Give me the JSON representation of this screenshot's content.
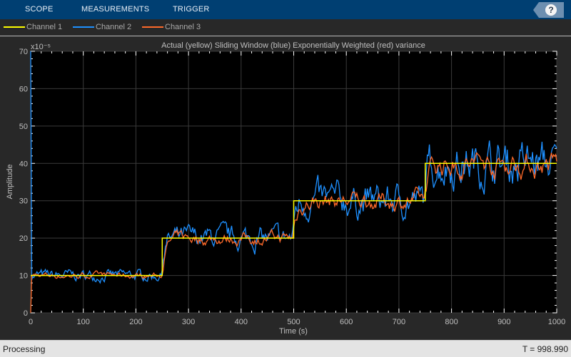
{
  "toolbar": {
    "tabs": [
      "SCOPE",
      "MEASUREMENTS",
      "TRIGGER"
    ],
    "help_label": "?"
  },
  "legend": [
    {
      "label": "Channel 1",
      "color": "#ffff00"
    },
    {
      "label": "Channel 2",
      "color": "#1e90ff"
    },
    {
      "label": "Channel 3",
      "color": "#ff6a2a"
    }
  ],
  "status": {
    "left": "Processing",
    "right": "T = 998.990"
  },
  "chart_data": {
    "type": "line",
    "title": "Actual (yellow) Sliding Window (blue) Exponentially Weighted (red) variance",
    "xlabel": "Time (s)",
    "ylabel": "Amplitude",
    "y_exponent": "x10⁻⁵",
    "xlim": [
      0,
      1000
    ],
    "ylim": [
      0,
      70
    ],
    "xticks": [
      0,
      100,
      200,
      300,
      400,
      500,
      600,
      700,
      800,
      900,
      1000
    ],
    "yticks": [
      0,
      10,
      20,
      30,
      40,
      50,
      60,
      70
    ],
    "grid": true,
    "legend_position": "top",
    "series": [
      {
        "name": "Channel 1",
        "color": "#ffff00",
        "steps": [
          {
            "from": 0,
            "to": 250,
            "value": 10
          },
          {
            "from": 250,
            "to": 500,
            "value": 20
          },
          {
            "from": 500,
            "to": 750,
            "value": 30
          },
          {
            "from": 750,
            "to": 1000,
            "value": 40
          }
        ]
      },
      {
        "name": "Channel 2",
        "color": "#1e90ff",
        "description_levels": [
          10,
          20,
          30,
          40
        ],
        "noise_pct": 0.08
      },
      {
        "name": "Channel 3",
        "color": "#ff6a2a",
        "description_levels": [
          10,
          20,
          30,
          40
        ],
        "noise_pct": 0.05
      }
    ]
  }
}
